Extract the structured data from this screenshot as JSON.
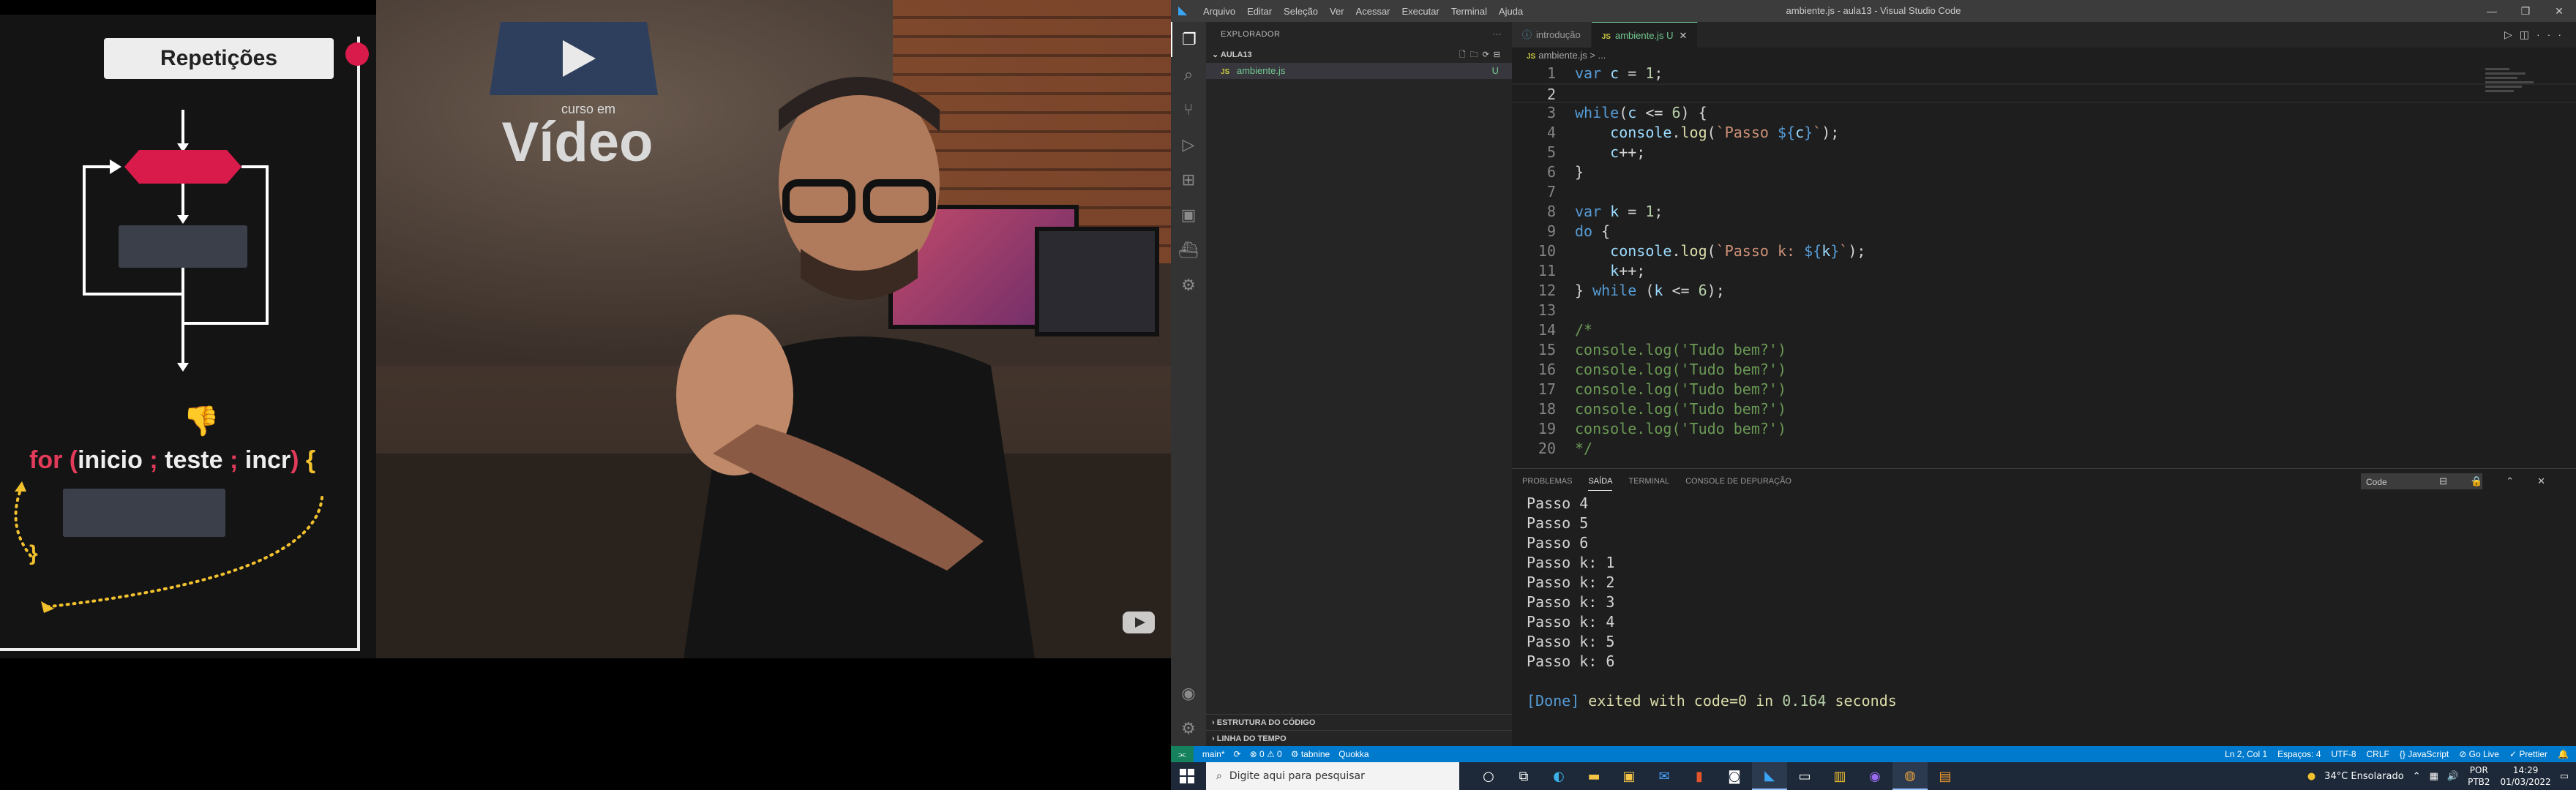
{
  "slide": {
    "title": "Repetições",
    "for_keyword": "for",
    "for_open": "(",
    "for_init": "inicio",
    "for_sep1": ";",
    "for_test": "teste",
    "for_sep2": ";",
    "for_incr": "incr",
    "for_close": ")",
    "for_brace_open": "{",
    "for_brace_close": "}"
  },
  "video": {
    "logo_text": "Vídeo",
    "logo_small": "curso em"
  },
  "vscode": {
    "menu": [
      "Arquivo",
      "Editar",
      "Seleção",
      "Ver",
      "Acessar",
      "Executar",
      "Terminal",
      "Ajuda"
    ],
    "window_title": "ambiente.js - aula13 - Visual Studio Code",
    "explorer_title": "EXPLORADOR",
    "folder": "AULA13",
    "file": "ambiente.js",
    "file_status": "U",
    "outline": "ESTRUTURA DO CÓDIGO",
    "timeline": "LINHA DO TEMPO",
    "tabs": [
      {
        "label": "introdução",
        "active": false
      },
      {
        "label": "ambiente.js",
        "status": "U",
        "active": true
      }
    ],
    "breadcrumb": "ambiente.js > ...",
    "panel_tabs": [
      "PROBLEMAS",
      "SAÍDA",
      "TERMINAL",
      "CONSOLE DE DEPURAÇÃO"
    ],
    "panel_select": "Code",
    "output": [
      "Passo 4",
      "Passo 5",
      "Passo 6",
      "Passo k: 1",
      "Passo k: 2",
      "Passo k: 3",
      "Passo k: 4",
      "Passo k: 5",
      "Passo k: 6",
      ""
    ],
    "done": {
      "tag": "[Done]",
      "exited": "exited with",
      "code": "code=0",
      "in": "in",
      "time": "0.164",
      "unit": "seconds"
    },
    "status_left": {
      "branch": "main*",
      "sync": "⟳",
      "errors": "⊗ 0 ⚠ 0",
      "tabnine": "⚙ tabnine",
      "quokka": "Quokka"
    },
    "status_right": [
      "Ln 2, Col 1",
      "Espaços: 4",
      "UTF-8",
      "CRLF",
      "{} JavaScript",
      "⊘ Go Live",
      "✓ Prettier"
    ]
  },
  "taskbar": {
    "search_placeholder": "Digite aqui para pesquisar",
    "weather": "34°C Ensolarado",
    "lang1": "POR",
    "lang2": "PTB2",
    "time": "14:29",
    "date": "01/03/2022"
  },
  "colors": {
    "accent": "#007acc",
    "slide_red": "#d81b4a",
    "slide_yellow": "#f2c12e"
  }
}
